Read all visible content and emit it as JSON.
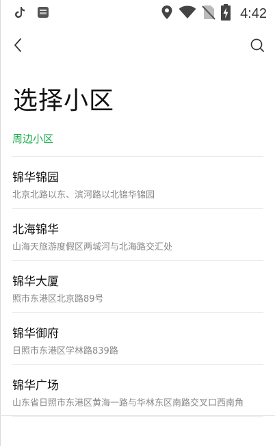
{
  "status_bar": {
    "time": "4:42",
    "icons": [
      "tiktok-icon",
      "notification-app-icon",
      "location-icon",
      "wifi-icon",
      "no-sim-icon",
      "battery-charging-icon"
    ]
  },
  "nav": {
    "back_icon": "chevron-left-icon",
    "search_icon": "search-icon"
  },
  "page": {
    "title": "选择小区",
    "section_label": "周边小区"
  },
  "communities": [
    {
      "name": "锦华锦园",
      "address": "北京北路以东、滨河路以北锦华锦园"
    },
    {
      "name": "北海锦华",
      "address": "山海天旅游度假区两城河与北海路交汇处"
    },
    {
      "name": "锦华大厦",
      "address": "照市东港区北京路89号"
    },
    {
      "name": "锦华御府",
      "address": "日照市东港区学林路839路"
    },
    {
      "name": "锦华广场",
      "address": "山东省日照市东港区黄海一路与华林东区南路交叉口西南角"
    }
  ],
  "colors": {
    "accent_green": "#1aad4d",
    "divider": "#e6e6e6",
    "secondary_text": "#888888"
  }
}
